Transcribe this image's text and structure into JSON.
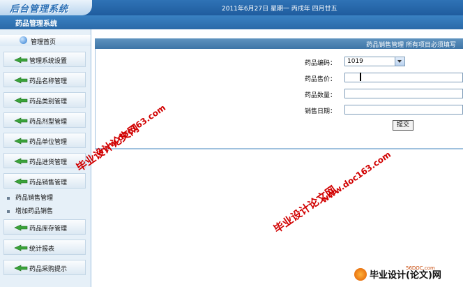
{
  "header": {
    "app_logo": "后台管理系统",
    "date": "2011年6月27日 星期一 丙戌年 四月廿五",
    "system_title": "药品管理系统"
  },
  "sidebar": {
    "home_label": "管理首页",
    "menu": [
      {
        "label": "管理系统设置"
      },
      {
        "label": "药品名称管理"
      },
      {
        "label": "药品类别管理"
      },
      {
        "label": "药品剂型管理"
      },
      {
        "label": "药品单位管理"
      },
      {
        "label": "药品进货管理"
      },
      {
        "label": "药品销售管理"
      }
    ],
    "sub_items": [
      {
        "label": "药品销售管理"
      },
      {
        "label": "增加药品销售"
      }
    ],
    "menu_bottom": [
      {
        "label": "药品库存管理"
      },
      {
        "label": "统计报表"
      },
      {
        "label": "药品采购提示"
      }
    ]
  },
  "main": {
    "header_text": "药品销售管理  所有项目必须填写",
    "fields": {
      "code_label": "药品编码：",
      "code_value": "1019",
      "price_label": "药品售价：",
      "quantity_label": "药品数量：",
      "date_label": "销售日期："
    },
    "submit_label": "提交"
  },
  "watermarks": {
    "wm1": "毕业设计论文网",
    "wm2": "www.doc163.com",
    "wm3": "毕业设计论文网",
    "wm4": "www.doc163.com",
    "brand": "毕业设计(论文)网",
    "brand_small": "56DOC.com"
  }
}
